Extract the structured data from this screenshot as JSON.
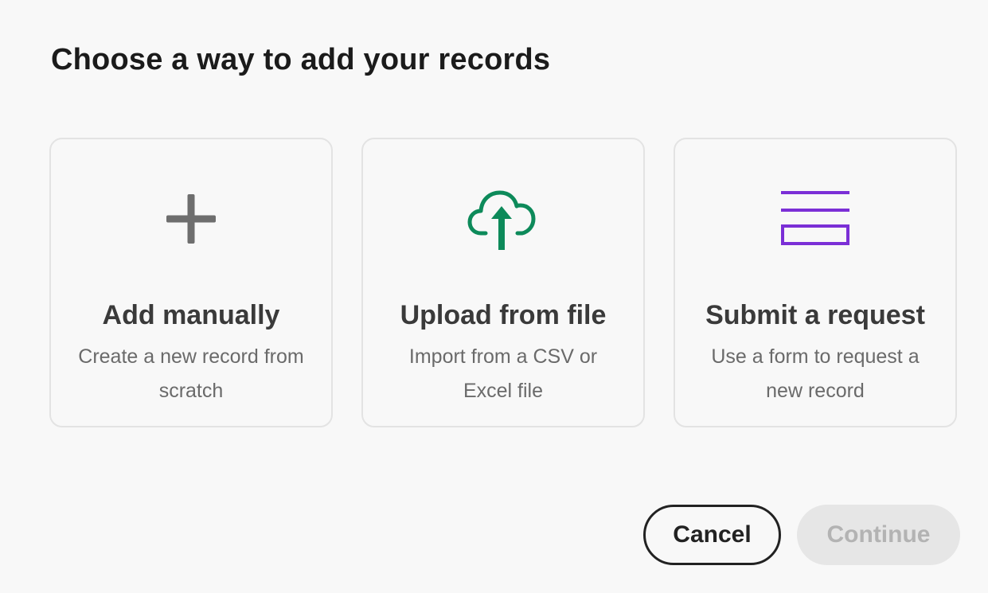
{
  "dialog": {
    "title": "Choose a way to add your records"
  },
  "options": [
    {
      "title": "Add manually",
      "description": "Create a new record from scratch",
      "icon": "plus-icon",
      "icon_color": "#6e6e6e"
    },
    {
      "title": "Upload from file",
      "description": "Import from a CSV or Excel file",
      "icon": "cloud-upload-icon",
      "icon_color": "#0d8a5a"
    },
    {
      "title": "Submit a request",
      "description": "Use a form to request a new record",
      "icon": "form-icon",
      "icon_color": "#7b2fd6"
    }
  ],
  "footer": {
    "cancel_label": "Cancel",
    "continue_label": "Continue",
    "continue_disabled": true
  }
}
